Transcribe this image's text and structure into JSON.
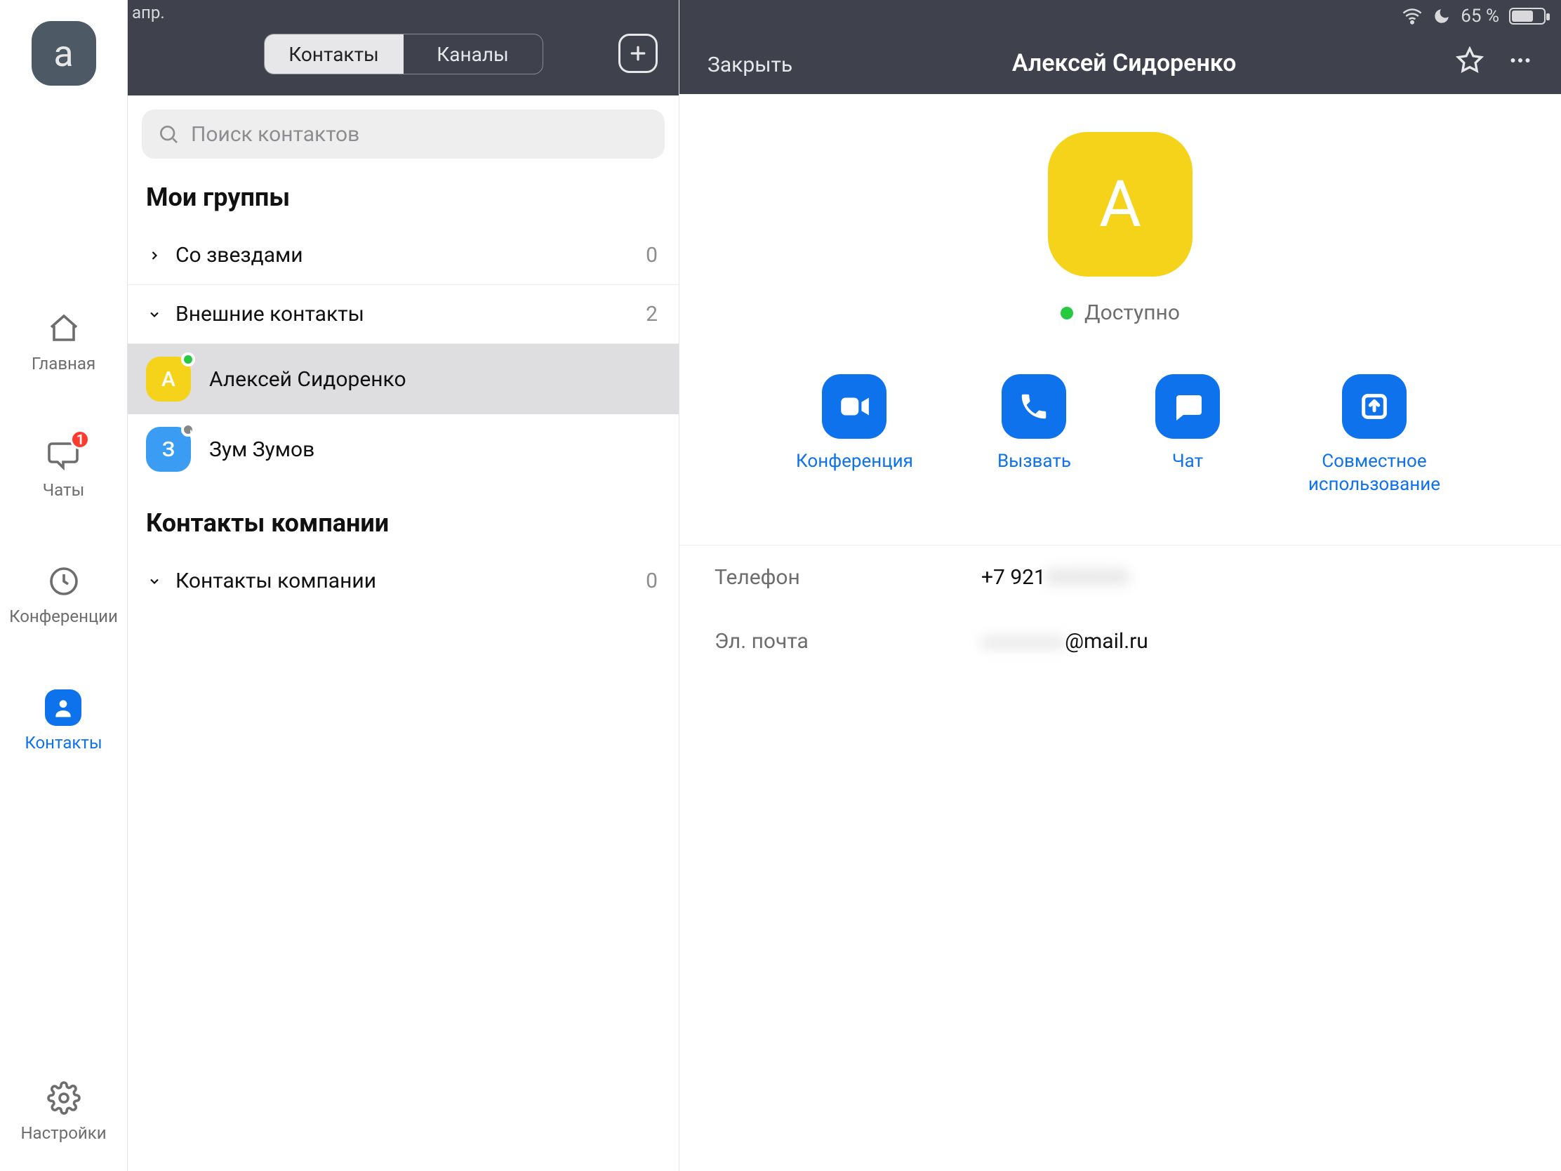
{
  "statusbar": {
    "left_fragment": "апр.",
    "battery": "65 %"
  },
  "profile": {
    "initial": "a"
  },
  "nav": {
    "home": "Главная",
    "chats": "Чаты",
    "chats_badge": "1",
    "meetings": "Конференции",
    "contacts": "Контакты",
    "settings": "Настройки"
  },
  "tabs": {
    "contacts": "Контакты",
    "channels": "Каналы"
  },
  "search": {
    "placeholder": "Поиск контактов"
  },
  "sections": {
    "my_groups": "Мои группы",
    "company": "Контакты компании"
  },
  "groups": {
    "starred": {
      "label": "Со звездами",
      "count": "0",
      "expanded": false
    },
    "external": {
      "label": "Внешние контакты",
      "count": "2",
      "expanded": true
    },
    "company": {
      "label": "Контакты компании",
      "count": "0",
      "expanded": true
    }
  },
  "contacts": [
    {
      "initial": "А",
      "name": "Алексей Сидоренко",
      "color": "#f5d31b",
      "presence": "online",
      "selected": true
    },
    {
      "initial": "З",
      "name": "Зум Зумов",
      "color": "#3a9cf2",
      "presence": "away",
      "selected": false
    }
  ],
  "detail": {
    "close": "Закрыть",
    "title": "Алексей Сидоренко",
    "avatar_initial": "А",
    "status": "Доступно",
    "actions": {
      "meet": "Конференция",
      "call": "Вызвать",
      "chat": "Чат",
      "share": "Совместное использование"
    },
    "info": {
      "phone_label": "Телефон",
      "phone_value_visible": "+7 921",
      "phone_value_hidden": "0000000",
      "email_label": "Эл. почта",
      "email_value_hidden": "xxxxxxxx",
      "email_value_visible": "@mail.ru"
    }
  }
}
